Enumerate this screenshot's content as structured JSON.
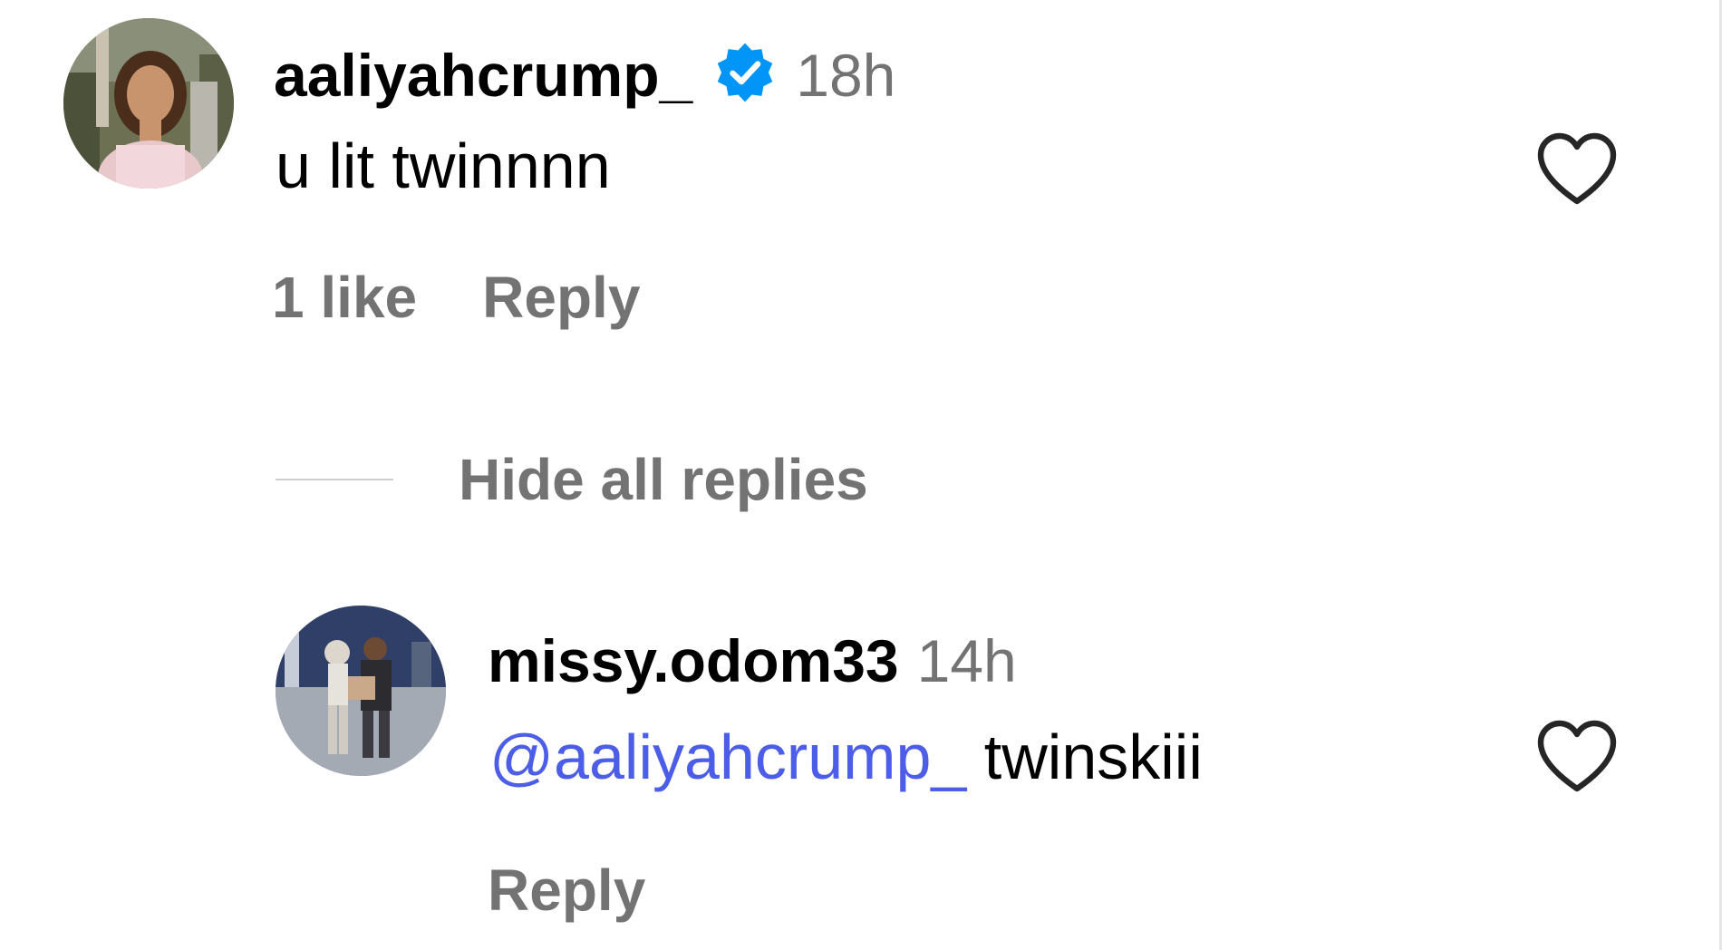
{
  "comment": {
    "username": "aaliyahcrump_",
    "verified": true,
    "time": "18h",
    "text": "u lit twinnnn",
    "likes_label": "1 like",
    "reply_label": "Reply",
    "avatar_icon": "profile-photo",
    "like_icon": "heart-outline-icon"
  },
  "replies_toggle": {
    "label": "Hide all replies"
  },
  "reply": {
    "username": "missy.odom33",
    "time": "14h",
    "mention": "@aaliyahcrump_",
    "text": "twinskiii",
    "reply_label": "Reply",
    "avatar_icon": "profile-photo",
    "like_icon": "heart-outline-icon"
  },
  "colors": {
    "username": "#000000",
    "secondary_text": "#737373",
    "mention": "#4c5de8",
    "verified_badge": "#0095f6",
    "divider": "#cfcfcf"
  }
}
